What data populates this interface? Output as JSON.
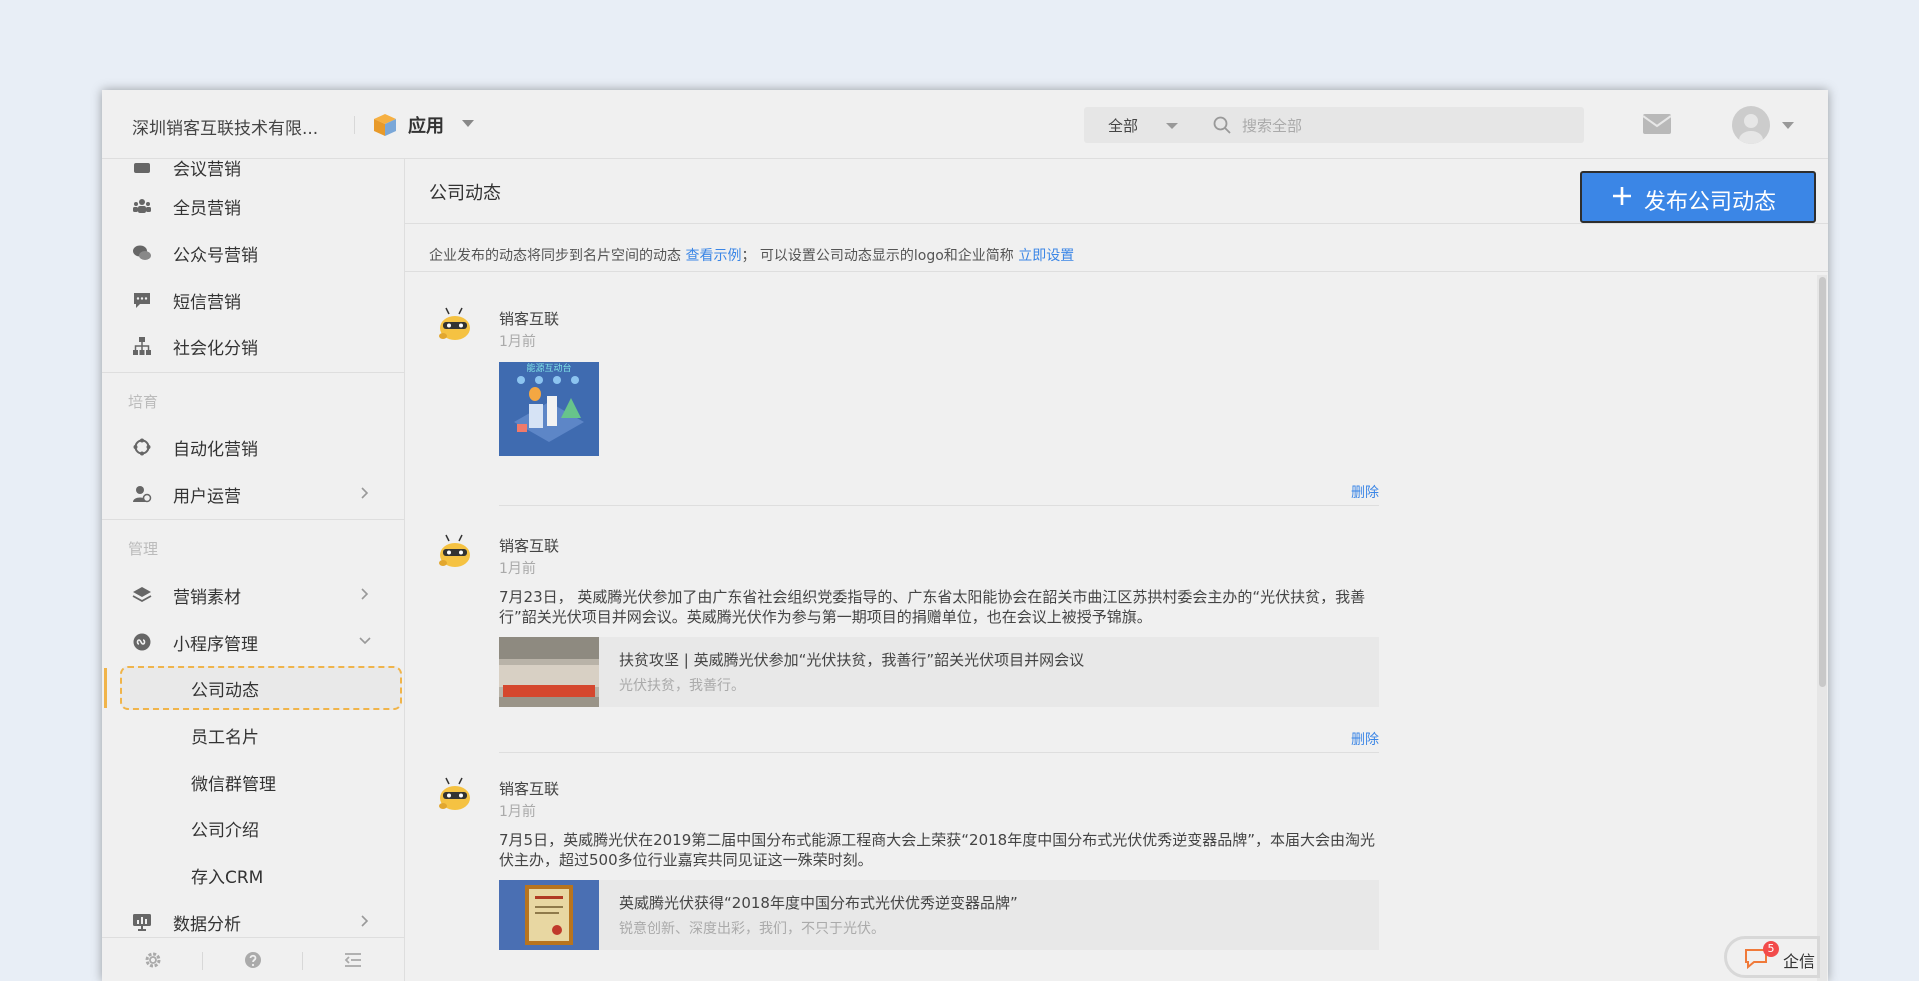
{
  "header": {
    "company": "深圳销客互联技术有限...",
    "app_label": "应用",
    "search_scope": "全部",
    "search_placeholder": "搜索全部"
  },
  "sidebar": {
    "items_top": [
      {
        "label": "会议营销",
        "icon": "meeting-icon"
      },
      {
        "label": "全员营销",
        "icon": "people-icon"
      },
      {
        "label": "公众号营销",
        "icon": "wechat-icon"
      },
      {
        "label": "短信营销",
        "icon": "sms-icon"
      },
      {
        "label": "社会化分销",
        "icon": "org-tree-icon"
      }
    ],
    "section_nurture": "培育",
    "items_nurture": [
      {
        "label": "自动化营销",
        "icon": "cycle-icon"
      },
      {
        "label": "用户运营",
        "icon": "user-gear-icon"
      }
    ],
    "section_manage": "管理",
    "items_manage": [
      {
        "label": "营销素材",
        "icon": "layers-icon"
      },
      {
        "label": "小程序管理",
        "icon": "miniprogram-icon"
      }
    ],
    "sub_items": [
      {
        "label": "公司动态"
      },
      {
        "label": "员工名片"
      },
      {
        "label": "微信群管理"
      },
      {
        "label": "公司介绍"
      },
      {
        "label": "存入CRM"
      }
    ],
    "item_data": {
      "label": "数据分析",
      "icon": "chart-icon"
    }
  },
  "main": {
    "page_title": "公司动态",
    "publish_label": "发布公司动态",
    "notice_prefix": "企业发布的动态将同步到名片空间的动态",
    "notice_link1": "查看示例",
    "notice_middle": "； 可以设置公司动态显示的logo和企业简称",
    "notice_link2": "立即设置",
    "delete_label": "删除",
    "posts": [
      {
        "author": "销客互联",
        "time": "1月前",
        "image_caption": "能源互动台"
      },
      {
        "author": "销客互联",
        "time": "1月前",
        "body": "7月23日， 英威腾光伏参加了由广东省社会组织党委指导的、广东省太阳能协会在韶关市曲江区苏拱村委会主办的“光伏扶贫，我善行”韶关光伏项目并网会议。英威腾光伏作为参与第一期项目的捐赠单位，也在会议上被授予锦旗。",
        "card_title": "扶贫攻坚 | 英威腾光伏参加“光伏扶贫，我善行”韶关光伏项目并网会议",
        "card_sub": "光伏扶贫，我善行。"
      },
      {
        "author": "销客互联",
        "time": "1月前",
        "body": "7月5日，英威腾光伏在2019第二届中国分布式能源工程商大会上荣获“2018年度中国分布式光伏优秀逆变器品牌”，本届大会由淘光伏主办，超过500多位行业嘉宾共同见证这一殊荣时刻。",
        "card_title": "英威腾光伏获得“2018年度中国分布式光伏优秀逆变器品牌”",
        "card_sub": "锐意创新、深度出彩，我们，不只于光伏。"
      }
    ]
  },
  "qixin": {
    "label": "企信",
    "badge": "5"
  },
  "colors": {
    "accent": "#3b86e6",
    "highlight": "#f0b44a",
    "badge": "#f24b4b"
  }
}
